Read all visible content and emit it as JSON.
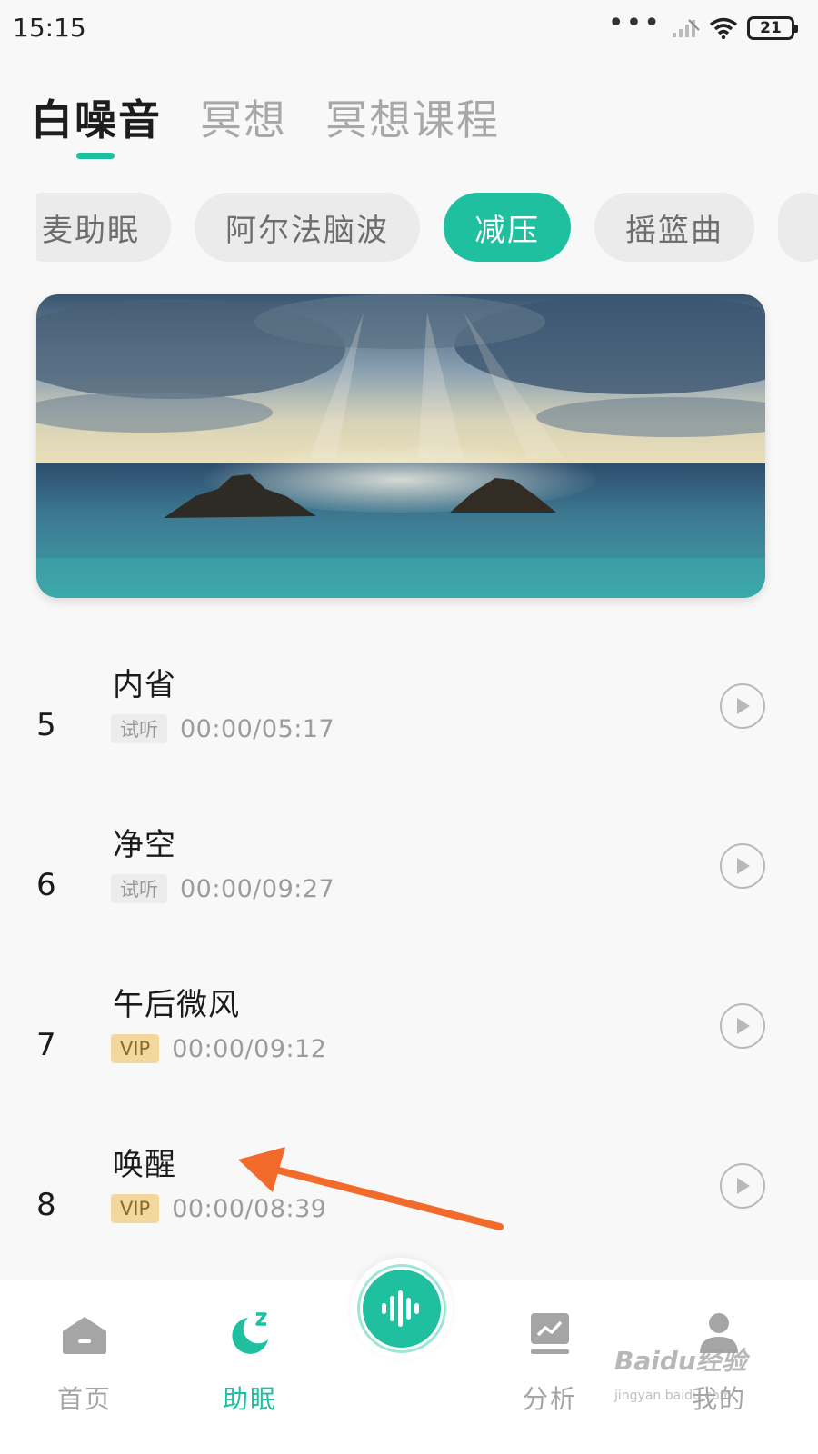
{
  "status": {
    "time": "15:15",
    "battery": "21"
  },
  "top_tabs": [
    {
      "label": "白噪音",
      "active": true
    },
    {
      "label": "冥想",
      "active": false
    },
    {
      "label": "冥想课程",
      "active": false
    }
  ],
  "chips": [
    {
      "label": "麦助眠",
      "active": false
    },
    {
      "label": "阿尔法脑波",
      "active": false
    },
    {
      "label": "减压",
      "active": true
    },
    {
      "label": "摇篮曲",
      "active": false
    }
  ],
  "tracks": [
    {
      "num": "5",
      "title": "内省",
      "badge": "试听",
      "badge_type": "trial",
      "duration": "00:00/05:17"
    },
    {
      "num": "6",
      "title": "净空",
      "badge": "试听",
      "badge_type": "trial",
      "duration": "00:00/09:27"
    },
    {
      "num": "7",
      "title": "午后微风",
      "badge": "VIP",
      "badge_type": "vip",
      "duration": "00:00/09:12"
    },
    {
      "num": "8",
      "title": "唤醒",
      "badge": "VIP",
      "badge_type": "vip",
      "duration": "00:00/08:39"
    }
  ],
  "nav": {
    "home": "首页",
    "sleep": "助眠",
    "analysis": "分析",
    "mine": "我的"
  },
  "watermark": {
    "main": "Baidu经验",
    "sub": "jingyan.baidu.com"
  },
  "colors": {
    "accent": "#1fc0a0",
    "vip": "#f3d89d",
    "arrow": "#f26b2a"
  }
}
